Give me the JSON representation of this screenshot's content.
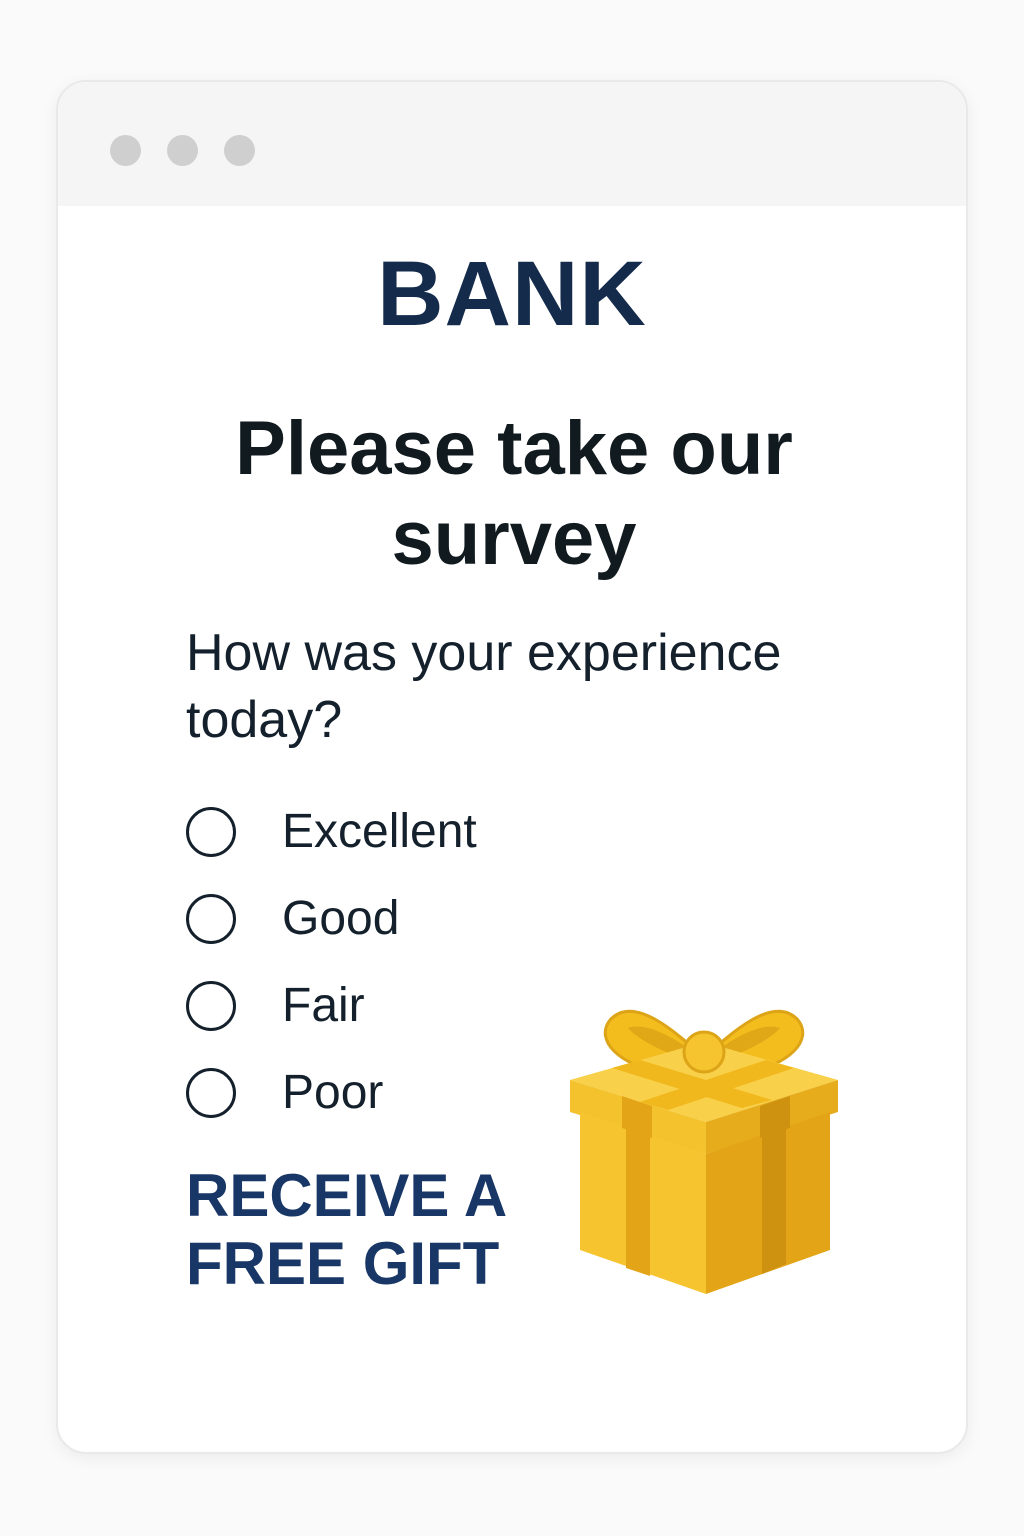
{
  "window": {
    "controls": [
      "window-dot",
      "window-dot",
      "window-dot"
    ]
  },
  "brand": "BANK",
  "headline": "Please take our survey",
  "question": "How was your experience today?",
  "options": [
    {
      "label": "Excellent"
    },
    {
      "label": "Good"
    },
    {
      "label": "Fair"
    },
    {
      "label": "Poor"
    }
  ],
  "promo": "RECEIVE A FREE GIFT",
  "icons": {
    "gift": "gift-icon"
  },
  "colors": {
    "brand": "#142b4c",
    "promo": "#183766",
    "gift_yellow": "#f6c42e",
    "gift_ribbon": "#e3a91a"
  }
}
